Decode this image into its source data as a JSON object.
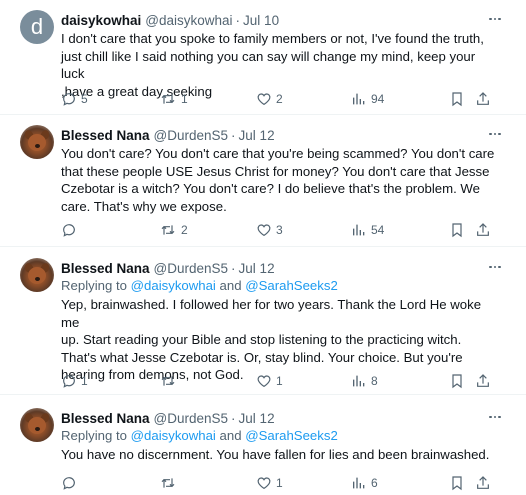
{
  "tweets": [
    {
      "display_name": "daisykowhai",
      "handle": "@daisykowhai",
      "separator": "·",
      "time": "Jul 10",
      "avatar_letter": "d",
      "text": "I don't care that you spoke to family members or not, I've found the truth,\njust chill like I said nothing you can say will change my mind, keep your luck\n,have a great day seeking",
      "replies": "5",
      "retweets": "1",
      "likes": "2",
      "views": "94"
    },
    {
      "display_name": "Blessed Nana",
      "handle": "@DurdenS5",
      "separator": "·",
      "time": "Jul 12",
      "text": "You don't care? You don't care that you're being scammed? You don't care\nthat these people USE Jesus Christ for money? You don't care that Jesse\nCzebotar is a witch? You don't care? I do believe that's the problem. We\ncare. That's why we expose.",
      "replies": "",
      "retweets": "2",
      "likes": "3",
      "views": "54"
    },
    {
      "display_name": "Blessed Nana",
      "handle": "@DurdenS5",
      "separator": "·",
      "time": "Jul 12",
      "replying_prefix": "Replying to ",
      "mention_1": "@daisykowhai",
      "replying_and": " and ",
      "mention_2": "@SarahSeeks2",
      "text": "Yep, brainwashed. I followed her for two years. Thank the Lord He woke me\nup. Start reading your Bible and stop listening to the practicing witch.\nThat's what Jesse Czebotar is.  Or, stay blind. Your choice. But you're\nhearing from demons, not God.",
      "replies": "1",
      "retweets": "",
      "likes": "1",
      "views": "8"
    },
    {
      "display_name": "Blessed Nana",
      "handle": "@DurdenS5",
      "separator": "·",
      "time": "Jul 12",
      "replying_prefix": "Replying to ",
      "mention_1": "@daisykowhai",
      "replying_and": " and ",
      "mention_2": "@SarahSeeks2",
      "text": "You have no discernment. You have fallen for lies and been brainwashed.",
      "replies": "",
      "retweets": "",
      "likes": "1",
      "views": "6"
    }
  ],
  "icons": {
    "reply": "reply-icon",
    "retweet": "retweet-icon",
    "like": "heart-icon",
    "views": "views-icon",
    "bookmark": "bookmark-icon",
    "share": "share-icon",
    "more": "more-icon"
  },
  "colors": {
    "text": "#0f1419",
    "secondary": "#536471",
    "link": "#1d9bf0",
    "divider": "#eff3f4"
  }
}
